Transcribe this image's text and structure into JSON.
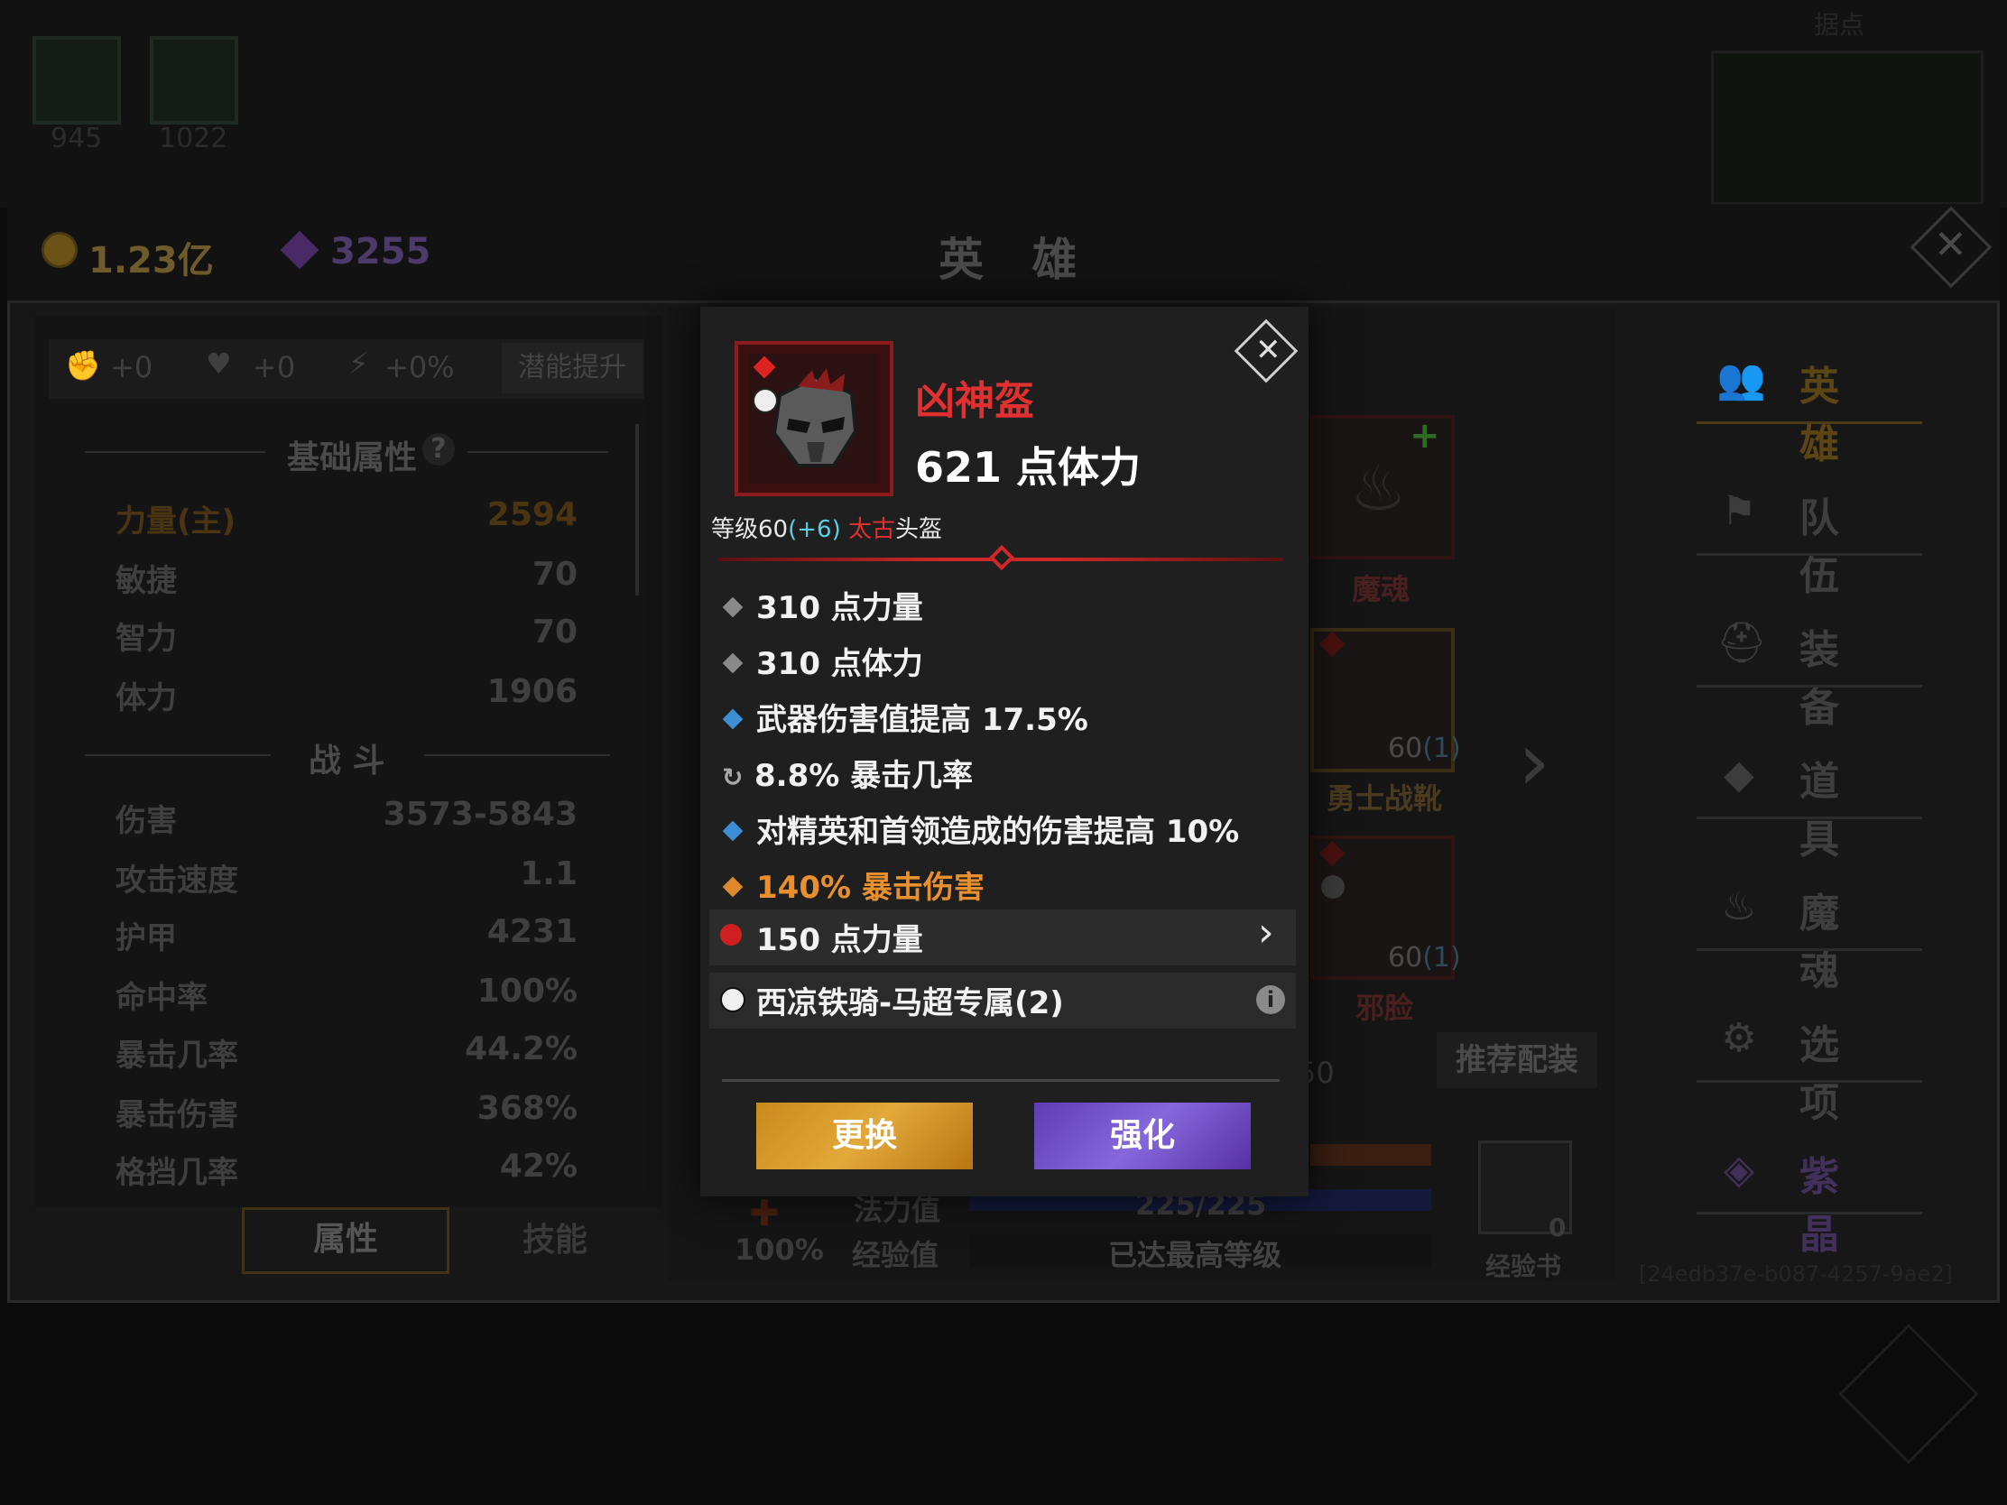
{
  "top_bar": {
    "slot1_count": "945",
    "slot2_count": "1022",
    "minimap_title": "据点"
  },
  "header": {
    "gold": "1.23亿",
    "gems": "3255",
    "title": "英 雄"
  },
  "potential": {
    "strength_bonus": "+0",
    "health_bonus": "+0",
    "speed_bonus": "+0%",
    "upgrade_label": "潜能提升"
  },
  "stats": {
    "basic_title": "基础属性",
    "help": "?",
    "basic": [
      {
        "name": "力量(主)",
        "value": "2594"
      },
      {
        "name": "敏捷",
        "value": "70"
      },
      {
        "name": "智力",
        "value": "70"
      },
      {
        "name": "体力",
        "value": "1906"
      }
    ],
    "combat_title": "战 斗",
    "combat": [
      {
        "name": "伤害",
        "value": "3573-5843"
      },
      {
        "name": "攻击速度",
        "value": "1.1"
      },
      {
        "name": "护甲",
        "value": "4231"
      },
      {
        "name": "命中率",
        "value": "100%"
      },
      {
        "name": "暴击几率",
        "value": "44.2%"
      },
      {
        "name": "暴击伤害",
        "value": "368%"
      },
      {
        "name": "格挡几率",
        "value": "42%"
      }
    ],
    "tab_attributes": "属性",
    "tab_skills": "技能"
  },
  "equipment_slots": {
    "soul_label": "魔魂",
    "boots_label": "勇士战靴",
    "boots_level": "60",
    "boots_plus": "(1)",
    "evil_face_label": "邪脸",
    "evil_face_level": "60",
    "evil_face_plus": "(1)",
    "partial_number": "50",
    "recommend_label": "推荐配装"
  },
  "bottom_info": {
    "percent": "100%",
    "mana_label": "法力值",
    "mana_value": "225/225",
    "exp_label": "经验值",
    "exp_value": "已达最高等级",
    "exp_book_count": "0",
    "exp_book_label": "经验书",
    "id": "[24edb37e-b087-4257-9ae2]"
  },
  "side_menu": [
    {
      "label": "英 雄",
      "icon": "users-icon"
    },
    {
      "label": "队 伍",
      "icon": "flag-icon"
    },
    {
      "label": "装 备",
      "icon": "helmet-icon"
    },
    {
      "label": "道 具",
      "icon": "bag-icon"
    },
    {
      "label": "魔 魂",
      "icon": "flame-icon"
    },
    {
      "label": "选 项",
      "icon": "gear-icon"
    },
    {
      "label": "紫 晶",
      "icon": "crystal-icon"
    }
  ],
  "item": {
    "name": "凶神盔",
    "main_stat": "621 点体力",
    "level_prefix": "等级60",
    "level_plus": "(+6)",
    "quality": "太古",
    "slot_type": "头盔",
    "attributes": [
      {
        "text": "310 点力量",
        "style": "gray"
      },
      {
        "text": "310 点体力",
        "style": "gray"
      },
      {
        "text": "武器伤害值提高 17.5%",
        "style": "blue"
      },
      {
        "text": "8.8% 暴击几率",
        "style": "refresh"
      },
      {
        "text": "对精英和首领造成的伤害提高 10%",
        "style": "blue"
      },
      {
        "text": "140% 暴击伤害",
        "style": "orange"
      }
    ],
    "gem": "150 点力量",
    "set_bonus": "西凉铁骑-马超专属(2)",
    "replace_button": "更换",
    "enhance_button": "强化"
  },
  "colors": {
    "item_name": "#e03030",
    "legendary_orange": "#e8902e",
    "replace_gold": "#e3a83a",
    "enhance_purple": "#8668dc"
  }
}
